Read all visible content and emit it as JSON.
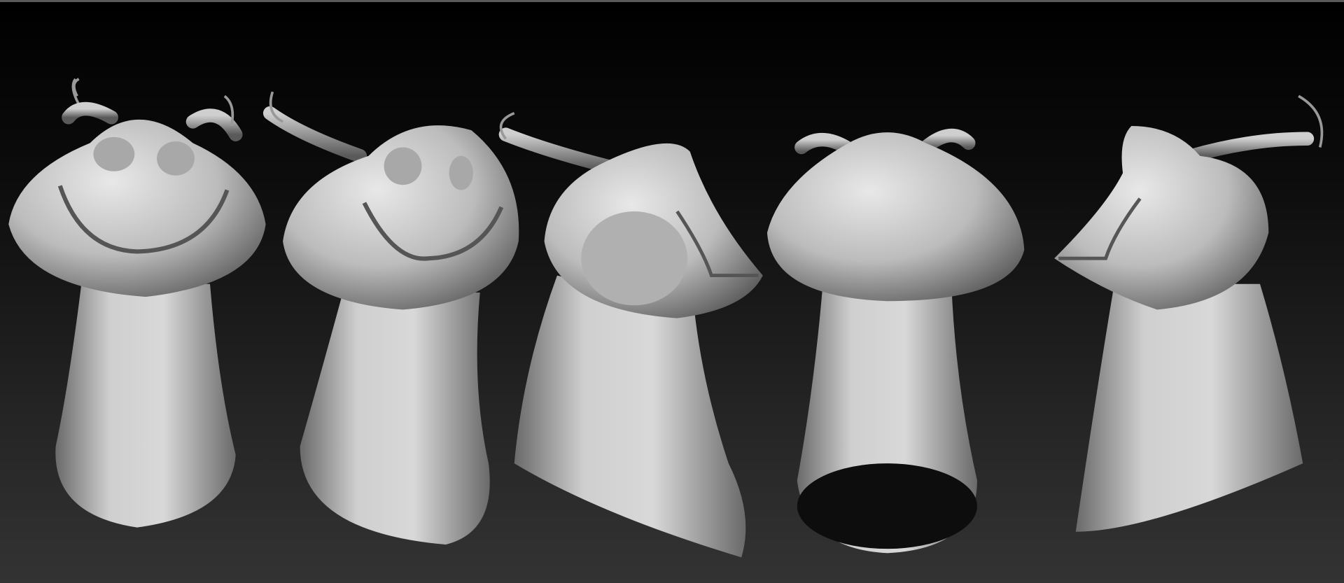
{
  "viewport": {
    "border_color": "#5a5a5a",
    "background_top": "#000000",
    "background_bottom": "#333333",
    "model_light": "#e6e6e6",
    "model_mid": "#b4b4b4",
    "model_dark": "#4a4a4a"
  },
  "model_count": 5
}
